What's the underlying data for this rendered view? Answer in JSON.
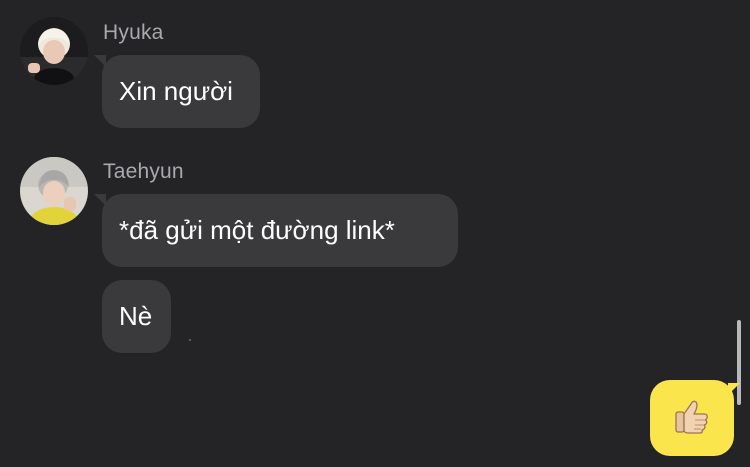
{
  "messages": [
    {
      "sender": "Hyuka",
      "bubbles": [
        "Xin người"
      ]
    },
    {
      "sender": "Taehyun",
      "bubbles": [
        "*đã gửi một đường link*",
        "Nè"
      ]
    }
  ],
  "reaction": {
    "icon": "thumbs-up-icon"
  },
  "colors": {
    "background": "#242426",
    "incoming_bubble": "#3a3a3c",
    "outgoing_bubble": "#fae54d",
    "sender_name": "#a9a9ad"
  }
}
